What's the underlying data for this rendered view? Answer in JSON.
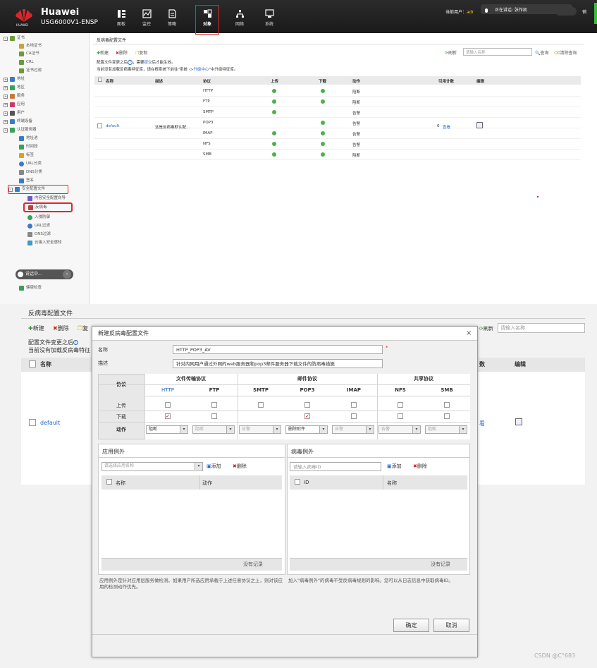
{
  "topbar": {
    "brand": "Huawei",
    "model": "USG6000V1-ENSP",
    "brand_small": "HUAWEI",
    "nav": [
      "面板",
      "监控",
      "策略",
      "对象",
      "网络",
      "系统"
    ],
    "current_user_label": "当前用户：",
    "current_user": "adr",
    "tip": "正在讲话: 张作凯",
    "right_partial": "销"
  },
  "sidebar": {
    "items": [
      "证书",
      "本地证书",
      "CA证书",
      "CRL",
      "证书过滤",
      "地址",
      "地区",
      "服务",
      "应用",
      "用户",
      "终端设备",
      "认证服务器",
      "地址池",
      "时间段",
      "标签",
      "URL分类",
      "DNS分类",
      "签名",
      "安全配置文件",
      "内容安全配置向导",
      "反病毒",
      "入侵防御",
      "URL过滤",
      "DNS过滤",
      "云接入安全感知",
      "健康检查"
    ],
    "toast": "说话中..."
  },
  "upper": {
    "title": "反病毒配置文件",
    "new": "新建",
    "delete": "删除",
    "copy": "复制",
    "refresh": "刷新",
    "search_placeholder": "请输入名称",
    "query": "查询",
    "clear_query": "清除查询",
    "notice1_a": "配置文件变更之后",
    "notice1_b": "，需要",
    "notice1_link": "提交",
    "notice1_c": "后才能生效。",
    "notice2_a": "当前没有加载反病毒特征库，请在根系统下前往\"系统 ->",
    "notice2_link": "升级中心",
    "notice2_b": "\"中升级特征库。",
    "headers": [
      "名称",
      "描述",
      "协议",
      "上传",
      "下载",
      "动作",
      "引用计数",
      "编辑"
    ],
    "row_name": "default",
    "row_desc": "这是反病毒默认配...",
    "protocols": [
      "HTTP",
      "FTP",
      "SMTP",
      "POP3",
      "IMAP",
      "NFS",
      "SMB"
    ],
    "upload": [
      true,
      true,
      true,
      false,
      true,
      true,
      true
    ],
    "download": [
      true,
      true,
      false,
      true,
      true,
      true,
      true
    ],
    "actions": [
      "阻断",
      "阻断",
      "告警",
      "告警",
      "告警",
      "告警",
      "阻断"
    ],
    "ref_count": "0",
    "view": "查看"
  },
  "lower": {
    "title": "反病毒配置文件",
    "new": "新建",
    "delete": "删除",
    "copy_partial": "复",
    "notice1": "配置文件变更之后",
    "notice2": "当前没有加载反病毒特征",
    "refresh": "刷新",
    "search_placeholder": "请输入名称",
    "col_name": "名称",
    "col_count_partial": "数",
    "col_edit": "编辑",
    "row_name": "default",
    "row_view_partial": "看"
  },
  "dialog": {
    "title": "新建反病毒配置文件",
    "close": "×",
    "name_label": "名称",
    "name_value": "HTTP_POP3_AV",
    "required_mark": "*",
    "desc_label": "描述",
    "desc_value": "针对内网用户通过外网的web服务器和pop3邮件服务器下载文件的防病毒措施",
    "group_file": "文件传输协议",
    "group_mail": "邮件协议",
    "group_share": "共享协议",
    "protocol_label": "协议",
    "upload_label": "上传",
    "download_label": "下载",
    "action_label": "动作",
    "protocols": [
      "HTTP",
      "FTP",
      "SMTP",
      "POP3",
      "IMAP",
      "NFS",
      "SMB"
    ],
    "help_on": [
      "IMAP",
      "NFS",
      "SMB"
    ],
    "help_mark": "?",
    "upload": [
      false,
      false,
      false,
      false,
      false,
      false,
      false
    ],
    "download": [
      true,
      false,
      false,
      true,
      false,
      false,
      false
    ],
    "upload_visible": [
      true,
      true,
      true,
      true,
      true,
      true,
      true
    ],
    "download_visible": [
      true,
      true,
      false,
      true,
      true,
      true,
      true
    ],
    "actions": [
      "阻断",
      "阻断",
      "告警",
      "删除附件",
      "告警",
      "告警",
      "阻断"
    ],
    "action_enabled": [
      true,
      false,
      false,
      true,
      false,
      false,
      false
    ],
    "app_exc_title": "应用例外",
    "app_select_placeholder": "请选择应用名称",
    "add": "添加",
    "delete": "删除",
    "app_col_name": "名称",
    "app_col_action": "动作",
    "no_record": "没有记录",
    "virus_exc_title": "病毒例外",
    "virus_input_placeholder": "请输入病毒ID",
    "virus_col_id": "ID",
    "virus_col_name": "名称",
    "note_left": "应用例外是针对应用层服务做检测。如果用户所选应用承载于上述任意协议之上，则对该应用的检测动作优先。",
    "note_right": "加入\"病毒例外\"的病毒不受反病毒规则的影响。您可以从日志信息中获取病毒ID。",
    "ok": "确定",
    "cancel": "取消"
  },
  "watermark": "CSDN @C°683",
  "colors": {
    "accent_red": "#e2262a",
    "link_blue": "#2468c8",
    "ok_green": "#4ab24a"
  }
}
